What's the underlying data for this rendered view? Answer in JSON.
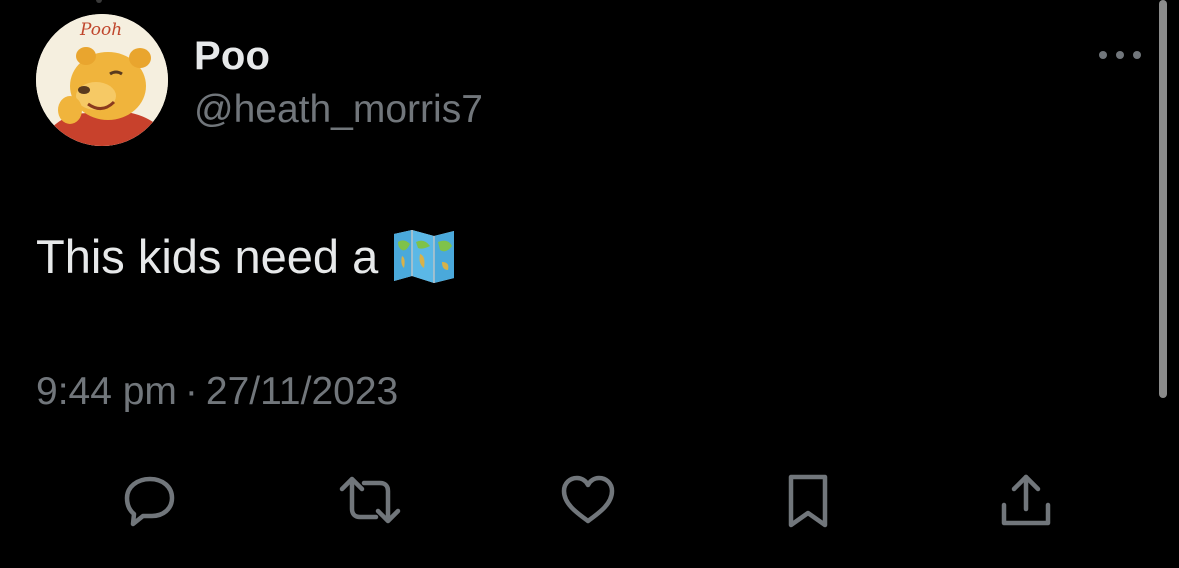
{
  "tweet": {
    "display_name": "Poo",
    "handle": "@heath_morris7",
    "avatar_label": "Pooh",
    "text": "This kids need a",
    "emoji": "world-map-emoji",
    "time": "9:44 pm",
    "separator": "·",
    "date": "27/11/2023"
  },
  "actions": [
    {
      "name": "reply",
      "icon": "reply-icon"
    },
    {
      "name": "retweet",
      "icon": "retweet-icon"
    },
    {
      "name": "like",
      "icon": "heart-icon"
    },
    {
      "name": "bookmark",
      "icon": "bookmark-icon"
    },
    {
      "name": "share",
      "icon": "share-icon"
    }
  ],
  "colors": {
    "background": "#000000",
    "text_primary": "#e7e9ea",
    "text_secondary": "#71767b",
    "icon": "#71767b"
  }
}
